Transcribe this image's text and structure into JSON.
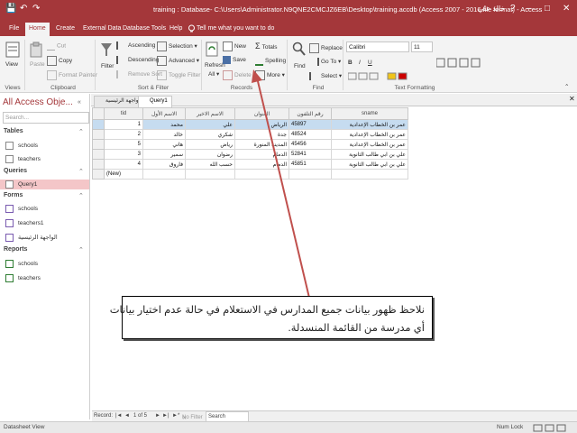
{
  "titlebar": {
    "title": "training : Database- C:\\Users\\Administrator.N9QNE2CMCJZ6EB\\Desktop\\training.accdb (Access 2007 - 2016 file format) - Access",
    "user": "خالد علي",
    "help_glyph": "?",
    "minimize": "–",
    "restore": "□",
    "close": "✕",
    "save_glyph": "💾",
    "undo_glyph": "↶",
    "redo_glyph": "↷"
  },
  "ribbon_tabs": [
    {
      "label": "File"
    },
    {
      "label": "Home"
    },
    {
      "label": "Create"
    },
    {
      "label": "External Data"
    },
    {
      "label": "Database Tools"
    },
    {
      "label": "Help"
    },
    {
      "label": "Tell me what you want to do"
    }
  ],
  "ribbon": {
    "view": "View",
    "paste": "Paste",
    "cut": "Cut",
    "copy": "Copy",
    "format_painter": "Format Painter",
    "filter": "Filter",
    "ascending": "Ascending",
    "descending": "Descending",
    "remove_sort": "Remove Sort",
    "selection": "Selection",
    "advanced": "Advanced",
    "toggle_filter": "Toggle Filter",
    "refresh": "Refresh",
    "refresh_all": "All",
    "new": "New",
    "save": "Save",
    "delete": "Delete",
    "totals": "Totals",
    "spelling": "Spelling",
    "more": "More",
    "find": "Find",
    "replace": "Replace",
    "goto": "Go To",
    "select": "Select",
    "font_name": "Calibri",
    "font_size": "11",
    "groups": {
      "views": "Views",
      "clipboard": "Clipboard",
      "sort_filter": "Sort & Filter",
      "records": "Records",
      "find": "Find",
      "text_formatting": "Text Formatting"
    }
  },
  "nav": {
    "header": "All Access Obje...",
    "search_placeholder": "Search...",
    "sections": [
      {
        "label": "Tables",
        "items": [
          "schools",
          "teachers"
        ]
      },
      {
        "label": "Queries",
        "items": [
          "Query1"
        ]
      },
      {
        "label": "Forms",
        "items": [
          "schools",
          "teachers1",
          "الواجهة الرئيسية"
        ]
      },
      {
        "label": "Reports",
        "items": [
          "schools",
          "teachers"
        ]
      }
    ]
  },
  "doc_tabs": [
    "الواجهة الرئيسية",
    "Query1"
  ],
  "table": {
    "headers": [
      "tid",
      "الاسم الأول",
      "الاسم الاخير",
      "العنوان",
      "رقم التلفون",
      "sname"
    ],
    "rows": [
      [
        "1",
        "محمد",
        "علي",
        "الرياض",
        "45897",
        "عمر بن الخطاب الإعدادية"
      ],
      [
        "2",
        "خالد",
        "شكري",
        "جدة",
        "48524",
        "عمر بن الخطاب الإعدادية"
      ],
      [
        "5",
        "هاني",
        "رياض",
        "المدينة المنورة",
        "45456",
        "عمر بن الخطاب الإعدادية"
      ],
      [
        "3",
        "سمير",
        "رضوان",
        "الدمام",
        "52841",
        "علي بن ابي طالب الثانوية"
      ],
      [
        "4",
        "فاروق",
        "حسب الله",
        "الدمام",
        "45851",
        "علي بن ابي طالب الثانوية"
      ]
    ],
    "new_row": "(New)"
  },
  "record_nav": {
    "label": "Record:",
    "first": "|◄",
    "prev": "◄",
    "current": "1 of 5",
    "next": "►",
    "last": "►|",
    "new": "►*",
    "filter": "No Filter",
    "search": "Search"
  },
  "status": {
    "left": "Datasheet View",
    "numlock": "Num Lock"
  },
  "callout": {
    "line1": "نلاحظ ظهور بيانات جميع المدارس في الاستعلام في حالة عدم اختيار بيانات",
    "line2": "أي مدرسة من القائمة المنسدلة."
  },
  "colors": {
    "accent": "#a4373a",
    "selection": "#f4c6c8",
    "arrow": "#c0504d",
    "row_highlight": "#c6dcf0"
  }
}
